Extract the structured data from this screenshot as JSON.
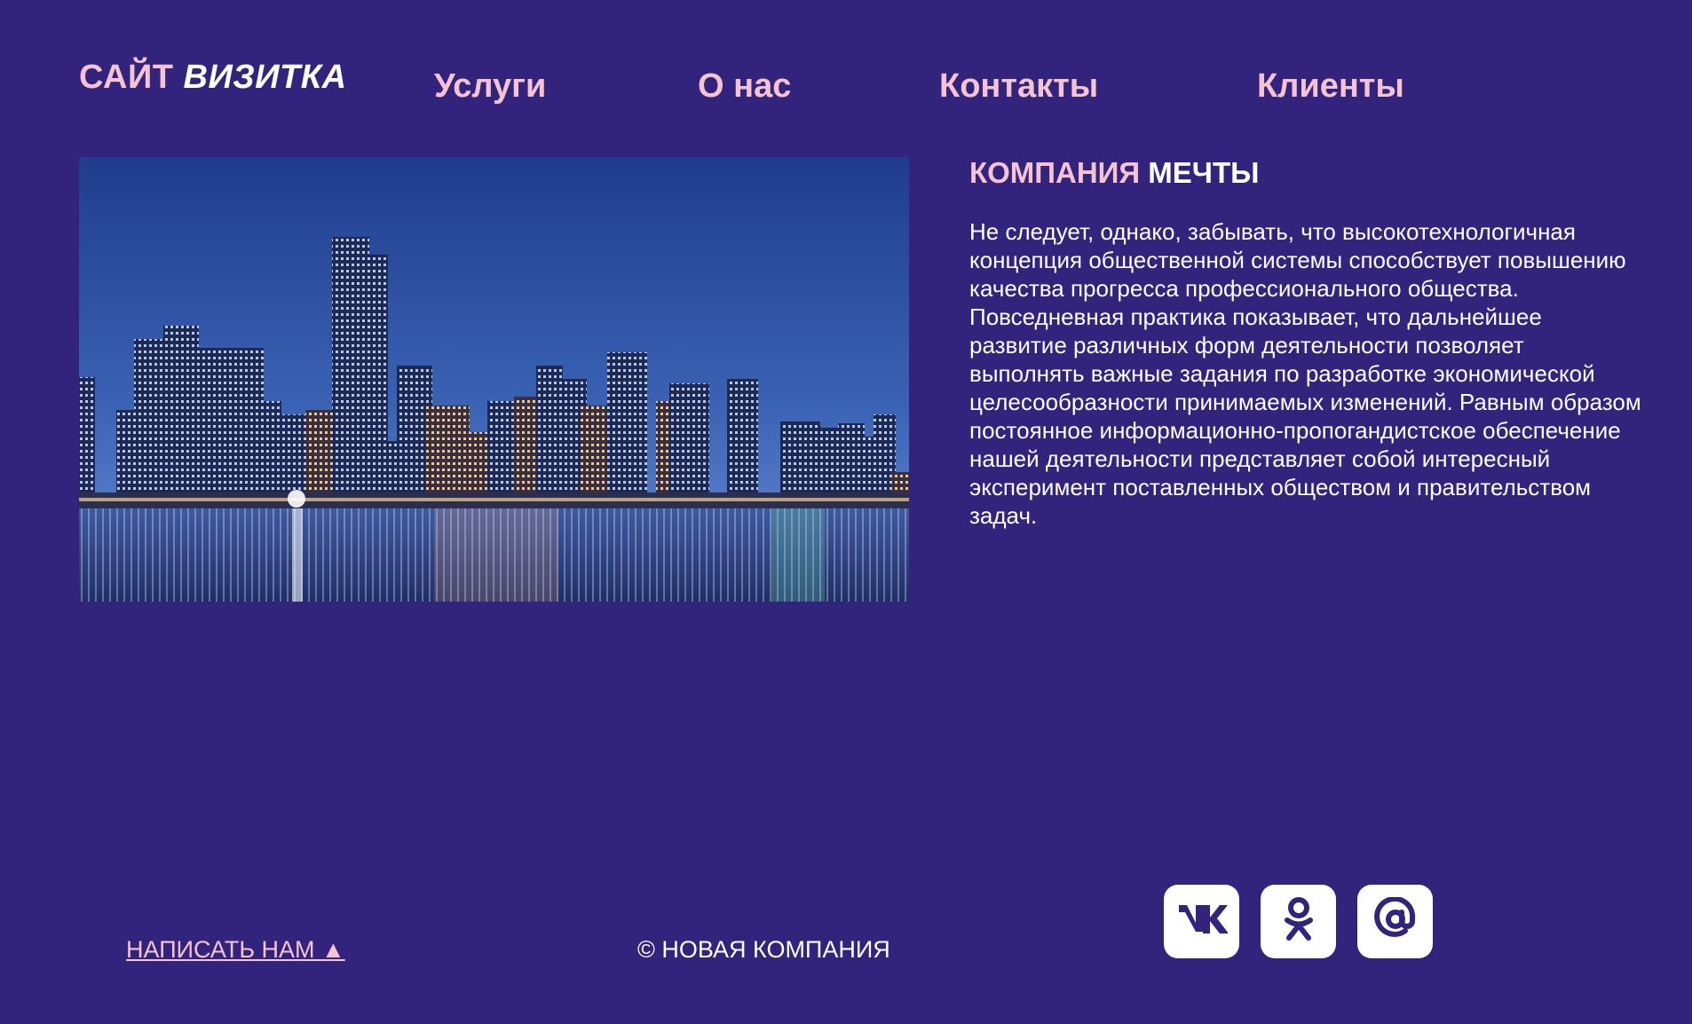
{
  "header": {
    "logo_part1": "САЙТ",
    "logo_part2": "ВИЗИТКА",
    "nav": [
      {
        "label": "Услуги"
      },
      {
        "label": "О нас"
      },
      {
        "label": "Контакты"
      },
      {
        "label": "Клиенты"
      }
    ]
  },
  "main": {
    "heading_part1": "КОМПАНИЯ",
    "heading_part2": "МЕЧТЫ",
    "paragraph": "Не следует, однако, забывать, что высокотехнологичная концепция общественной системы способствует повышению качества прогресса профессионального общества. Повседневная практика показывает, что дальнейшее развитие различных форм деятельности позволяет выполнять важные задания по разработке экономической целесообразности принимаемых изменений. Равным образом постоянное информационно-пропогандистское обеспечение нашей деятельности представляет собой интересный эксперимент поставленных обществом и правительством задач."
  },
  "footer": {
    "write_us": "НАПИСАТЬ НАМ ▲",
    "copyright": "© НОВАЯ КОМПАНИЯ",
    "social": [
      {
        "icon": "vk-icon"
      },
      {
        "icon": "odnoklassniki-icon"
      },
      {
        "icon": "email-at-icon"
      }
    ]
  },
  "colors": {
    "background": "#32237c",
    "accent_pink": "#f6c3d2",
    "text_white": "#ffffff"
  }
}
